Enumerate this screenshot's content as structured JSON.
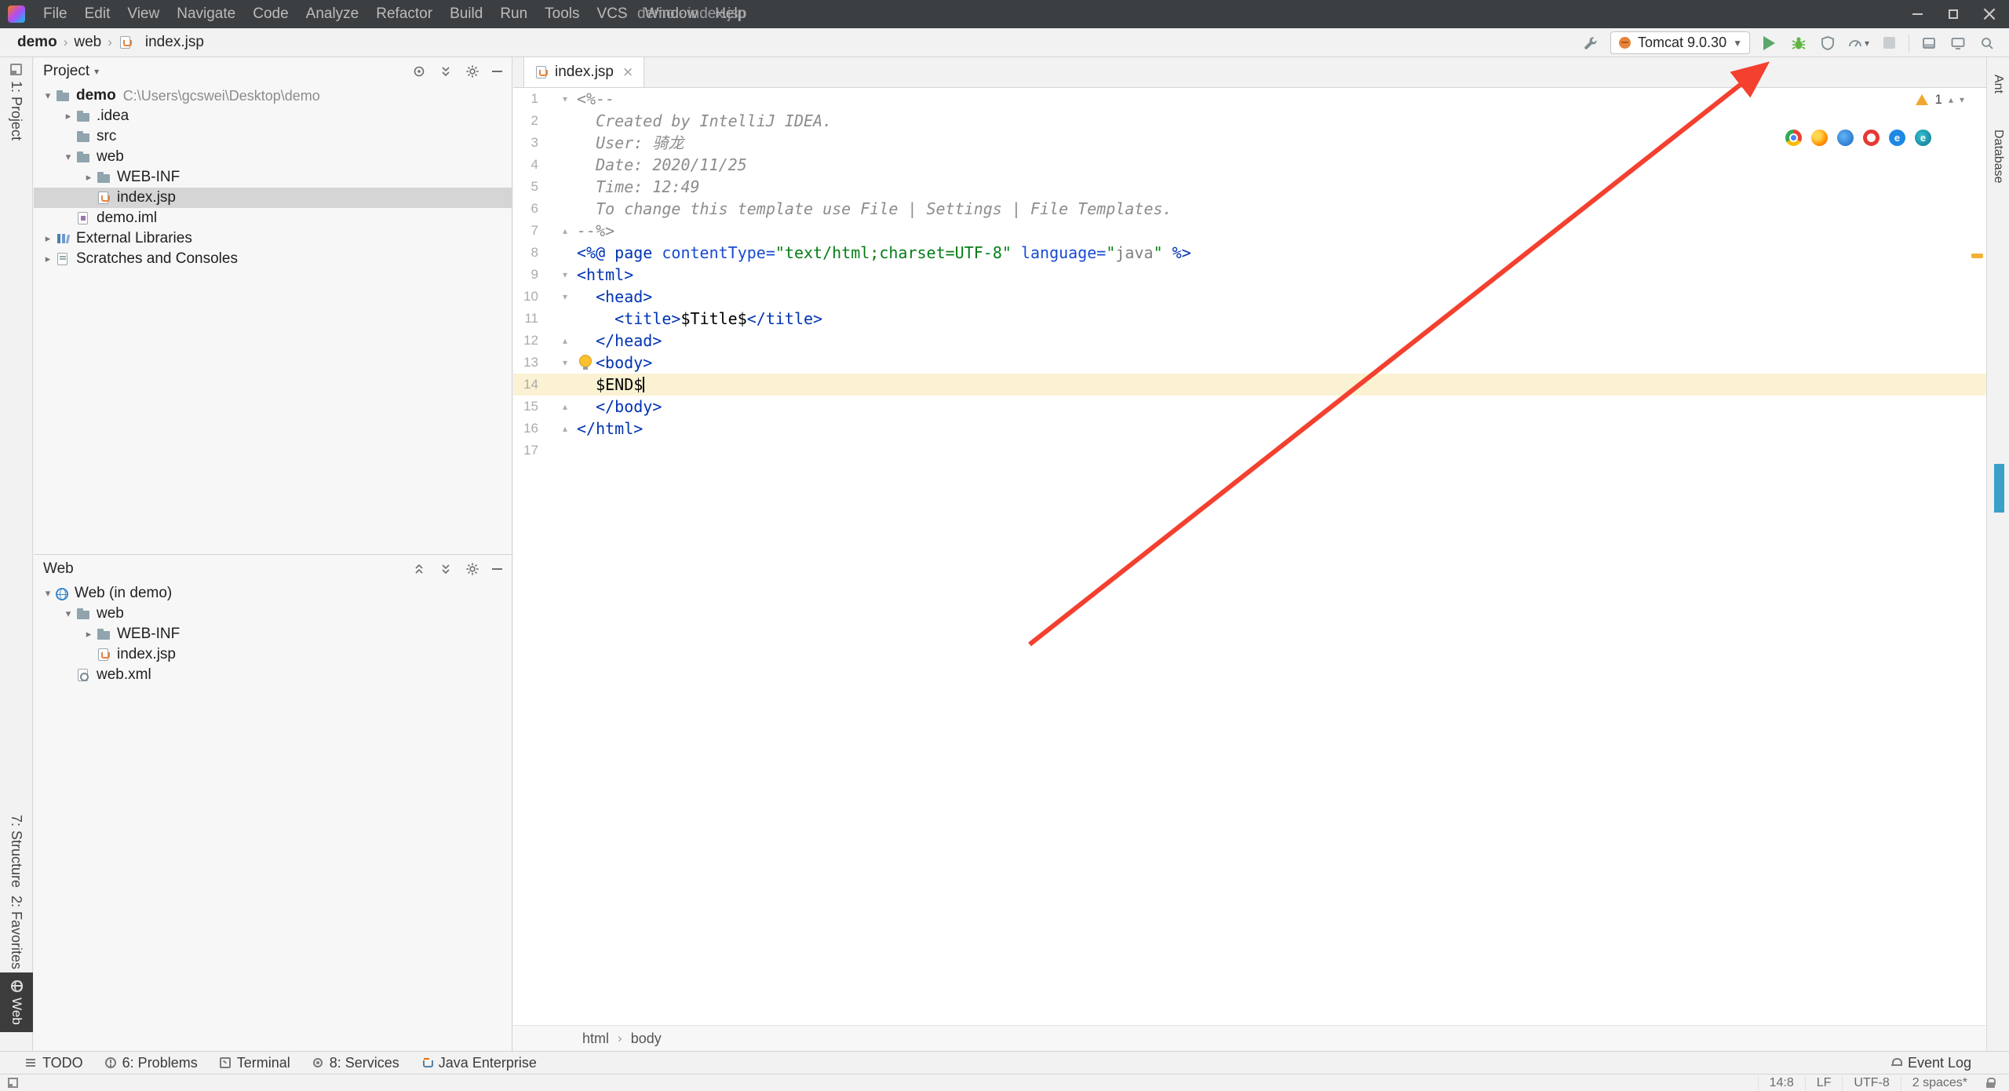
{
  "window": {
    "title": "demo - index.jsp",
    "menus": [
      "File",
      "Edit",
      "View",
      "Navigate",
      "Code",
      "Analyze",
      "Refactor",
      "Build",
      "Run",
      "Tools",
      "VCS",
      "Window",
      "Help"
    ]
  },
  "navbar": {
    "breadcrumbs": [
      "demo",
      "web",
      "index.jsp"
    ],
    "run_config": "Tomcat 9.0.30"
  },
  "stripes": {
    "left_top": "1: Project",
    "left_bottom": [
      "7: Structure",
      "2: Favorites"
    ],
    "left_active": "Web",
    "right": [
      "Ant",
      "Database"
    ]
  },
  "project_panel": {
    "title": "Project",
    "tree": [
      {
        "label": "demo",
        "path": "C:\\Users\\gcswei\\Desktop\\demo",
        "icon": "folder",
        "indent": 0,
        "chevron": "down",
        "bold": true
      },
      {
        "label": ".idea",
        "icon": "folder",
        "indent": 1,
        "chevron": "right"
      },
      {
        "label": "src",
        "icon": "folder",
        "indent": 1,
        "chevron": "none"
      },
      {
        "label": "web",
        "icon": "folder",
        "indent": 1,
        "chevron": "down"
      },
      {
        "label": "WEB-INF",
        "icon": "folder",
        "indent": 2,
        "chevron": "right"
      },
      {
        "label": "index.jsp",
        "icon": "jsp",
        "indent": 2,
        "chevron": "none",
        "selected": true
      },
      {
        "label": "demo.iml",
        "icon": "iml",
        "indent": 1,
        "chevron": "none"
      },
      {
        "label": "External Libraries",
        "icon": "lib",
        "indent": 0,
        "chevron": "right"
      },
      {
        "label": "Scratches and Consoles",
        "icon": "scratch",
        "indent": 0,
        "chevron": "right"
      }
    ]
  },
  "web_panel": {
    "title": "Web",
    "tree": [
      {
        "label": "Web (in demo)",
        "icon": "webfacet",
        "indent": 0,
        "chevron": "down"
      },
      {
        "label": "web",
        "icon": "folder",
        "indent": 1,
        "chevron": "down"
      },
      {
        "label": "WEB-INF",
        "icon": "folder",
        "indent": 2,
        "chevron": "right"
      },
      {
        "label": "index.jsp",
        "icon": "jsp",
        "indent": 2,
        "chevron": "none"
      },
      {
        "label": "web.xml",
        "icon": "xml",
        "indent": 1,
        "chevron": "none"
      }
    ]
  },
  "editor": {
    "tab": "index.jsp",
    "warning_count": "1",
    "breadcrumbs": [
      "html",
      "body"
    ],
    "current_line": 14,
    "browser_icons": [
      "chrome",
      "firefox",
      "safari",
      "opera",
      "ie",
      "edge"
    ],
    "lines": [
      {
        "n": 1,
        "fold": "down",
        "tokens": [
          {
            "t": "<%--",
            "c": "comment"
          }
        ]
      },
      {
        "n": 2,
        "tokens": [
          {
            "t": "  Created by IntelliJ IDEA.",
            "c": "comment"
          }
        ]
      },
      {
        "n": 3,
        "tokens": [
          {
            "t": "  User: 骑龙",
            "c": "comment"
          }
        ]
      },
      {
        "n": 4,
        "tokens": [
          {
            "t": "  Date: 2020/11/25",
            "c": "comment"
          }
        ]
      },
      {
        "n": 5,
        "tokens": [
          {
            "t": "  Time: 12:49",
            "c": "comment"
          }
        ]
      },
      {
        "n": 6,
        "tokens": [
          {
            "t": "  To change this template use File | Settings | File Templates.",
            "c": "comment"
          }
        ]
      },
      {
        "n": 7,
        "fold": "up",
        "tokens": [
          {
            "t": "--%>",
            "c": "comment"
          }
        ]
      },
      {
        "n": 8,
        "tokens": [
          {
            "t": "<%@ ",
            "c": "tag"
          },
          {
            "t": "page ",
            "c": "tag"
          },
          {
            "t": "contentType=",
            "c": "attr"
          },
          {
            "t": "\"text/html;charset=UTF-8\"",
            "c": "string"
          },
          {
            "t": " ",
            "c": "plain"
          },
          {
            "t": "language=",
            "c": "attr"
          },
          {
            "t": "\"",
            "c": "string"
          },
          {
            "t": "java",
            "c": "injected"
          },
          {
            "t": "\"",
            "c": "string"
          },
          {
            "t": " %>",
            "c": "tag"
          }
        ]
      },
      {
        "n": 9,
        "fold": "down",
        "tokens": [
          {
            "t": "<html>",
            "c": "tag"
          }
        ]
      },
      {
        "n": 10,
        "fold": "down",
        "tokens": [
          {
            "t": "  ",
            "c": "plain"
          },
          {
            "t": "<head>",
            "c": "tag"
          }
        ]
      },
      {
        "n": 11,
        "tokens": [
          {
            "t": "    ",
            "c": "plain"
          },
          {
            "t": "<title>",
            "c": "tag"
          },
          {
            "t": "$Title$",
            "c": "plain"
          },
          {
            "t": "</title>",
            "c": "tag"
          }
        ]
      },
      {
        "n": 12,
        "fold": "up",
        "tokens": [
          {
            "t": "  ",
            "c": "plain"
          },
          {
            "t": "</head>",
            "c": "tag"
          }
        ]
      },
      {
        "n": 13,
        "fold": "down",
        "bulb": true,
        "tokens": [
          {
            "t": "<body>",
            "c": "tag"
          }
        ]
      },
      {
        "n": 14,
        "caret": true,
        "tokens": [
          {
            "t": "  $END$",
            "c": "plain"
          }
        ]
      },
      {
        "n": 15,
        "fold": "up",
        "tokens": [
          {
            "t": "  ",
            "c": "plain"
          },
          {
            "t": "</body>",
            "c": "tag"
          }
        ]
      },
      {
        "n": 16,
        "fold": "up",
        "tokens": [
          {
            "t": "</html>",
            "c": "tag"
          }
        ]
      },
      {
        "n": 17,
        "tokens": []
      }
    ]
  },
  "bottom_bar": {
    "left": [
      {
        "icon": "todo",
        "label": "TODO"
      },
      {
        "icon": "problems",
        "label": "6: Problems"
      },
      {
        "icon": "terminal",
        "label": "Terminal"
      },
      {
        "icon": "services",
        "label": "8: Services"
      },
      {
        "icon": "java-ee",
        "label": "Java Enterprise"
      }
    ],
    "right": [
      {
        "icon": "event-log",
        "label": "Event Log"
      }
    ]
  },
  "status_bar": {
    "items": [
      "14:8",
      "LF",
      "UTF-8",
      "2 spaces*"
    ]
  }
}
